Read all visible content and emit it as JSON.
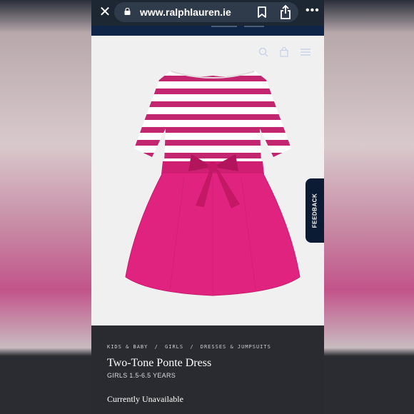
{
  "browser": {
    "url": "www.ralphlauren.ie",
    "more_label": "•••"
  },
  "feedback": {
    "label": "FEEDBACK"
  },
  "breadcrumb": {
    "items": [
      "KIDS & BABY",
      "/",
      "GIRLS",
      "/",
      "DRESSES & JUMPSUITS"
    ]
  },
  "product": {
    "title": "Two-Tone Ponte Dress",
    "size_range": "GIRLS 1.5-6.5 YEARS",
    "availability": "Currently Unavailable"
  },
  "colors": {
    "stripe": "#c2266f",
    "skirt": "#e0237f",
    "site_nav": "#0e2547"
  }
}
